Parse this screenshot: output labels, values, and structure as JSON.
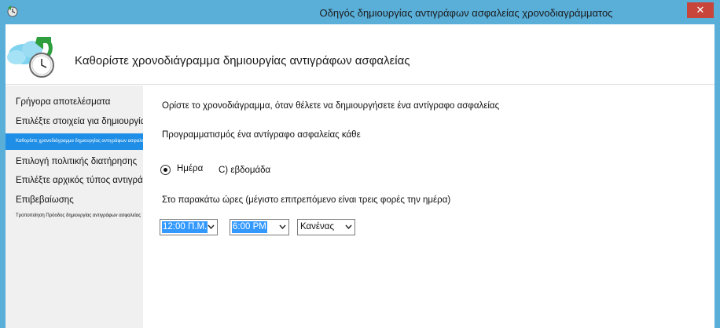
{
  "window": {
    "title": "Οδηγός δημιουργίας αντιγράφων ασφαλείας χρονοδιαγράμματος",
    "close_label": "✕"
  },
  "header": {
    "title": "Καθορίστε χρονοδιάγραμμα δημιουργίας αντιγράφων ασφαλείας"
  },
  "nav": {
    "items": [
      {
        "label": "Γρήγορα αποτελέσματα"
      },
      {
        "label": "Επιλέξτε στοιχεία για δημιουργία αντιγράφων ασφαλείας"
      },
      {
        "label": "Καθορίστε χρονοδιάγραμμα δημιουργίας αντιγράφων ασφαλείας"
      },
      {
        "label": "Επιλογή πολιτικής διατήρησης"
      },
      {
        "label": "Επιλέξτε αρχικός τύπος αντιγράφων ασφαλείας"
      },
      {
        "label": "Επιβεβαίωσης"
      },
      {
        "label": "Τροποποίηση Πρόοδος δημιουργίας αντιγράφων ασφαλείας"
      }
    ]
  },
  "main": {
    "intro": "Ορίστε το χρονοδιάγραμμα, όταν θέλετε να δημιουργήσετε ένα αντίγραφο ασφαλείας",
    "schedule_label": "Προγραμματισμός ένα αντίγραφο ασφαλείας κάθε",
    "radio_day": "Ημέρα",
    "radio_week": "C) εβδομάδα",
    "times_label": "Στο παρακάτω ώρες (μέγιστο επιτρεπόμενο είναι τρεις φορές την ημέρα)",
    "time1": "12:00 Π.Μ.",
    "time2": "6:00 PM",
    "time3": "Κανένας"
  },
  "colors": {
    "chrome": "#5aafd9",
    "accent": "#1e8ee6",
    "nav_bg": "#f0f0f0",
    "close": "#c7453a"
  }
}
